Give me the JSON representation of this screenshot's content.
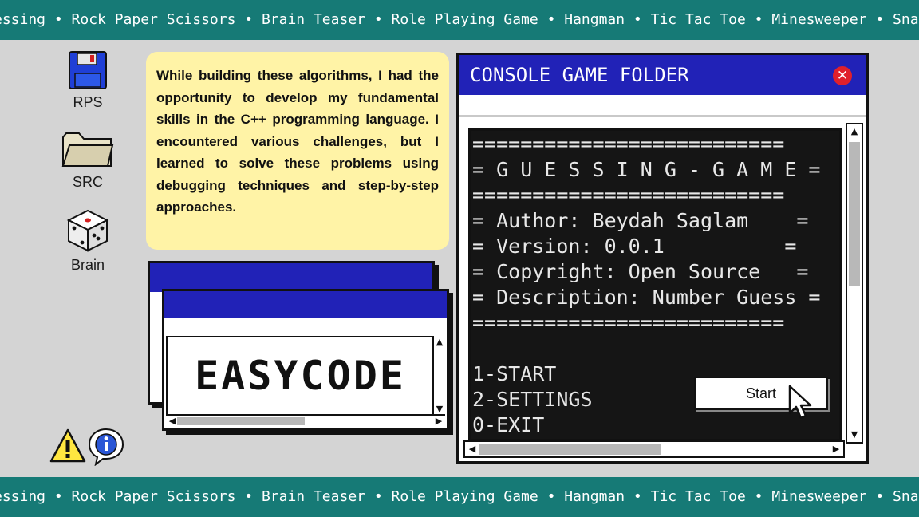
{
  "ticker": {
    "text": "essing • Rock Paper Scissors • Brain Teaser • Role Playing Game • Hangman • Tic Tac Toe • Minesweeper • Snake Game • Spac"
  },
  "desktop_icons": [
    {
      "label": "RPS",
      "icon": "floppy-disk-icon"
    },
    {
      "label": "SRC",
      "icon": "folder-icon"
    },
    {
      "label": "Brain",
      "icon": "dice-icon"
    }
  ],
  "note": {
    "text": "While building these algorithms, I had the opportunity to develop my fundamental skills in the C++ programming language. I encountered various challenges, but I learned to solve these problems using debugging techniques and step-by-step approaches."
  },
  "easycode_window": {
    "label": "EASYCODE"
  },
  "console_window": {
    "title": "CONSOLE GAME FOLDER",
    "close_glyph": "✕",
    "terminal_lines": [
      "==========================",
      "= G U E S S I N G - G A M E =",
      "==========================",
      "= Author: Beydah Saglam    =",
      "= Version: 0.0.1          =",
      "= Copyright: Open Source   =",
      "= Description: Number Guess =",
      "==========================",
      "1-START",
      "2-SETTINGS",
      "0-EXIT"
    ],
    "start_button_label": "Start"
  },
  "colors": {
    "teal": "#167a76",
    "title_blue": "#2122b7",
    "note_yellow": "#fff3a6",
    "close_red": "#e0202c"
  }
}
